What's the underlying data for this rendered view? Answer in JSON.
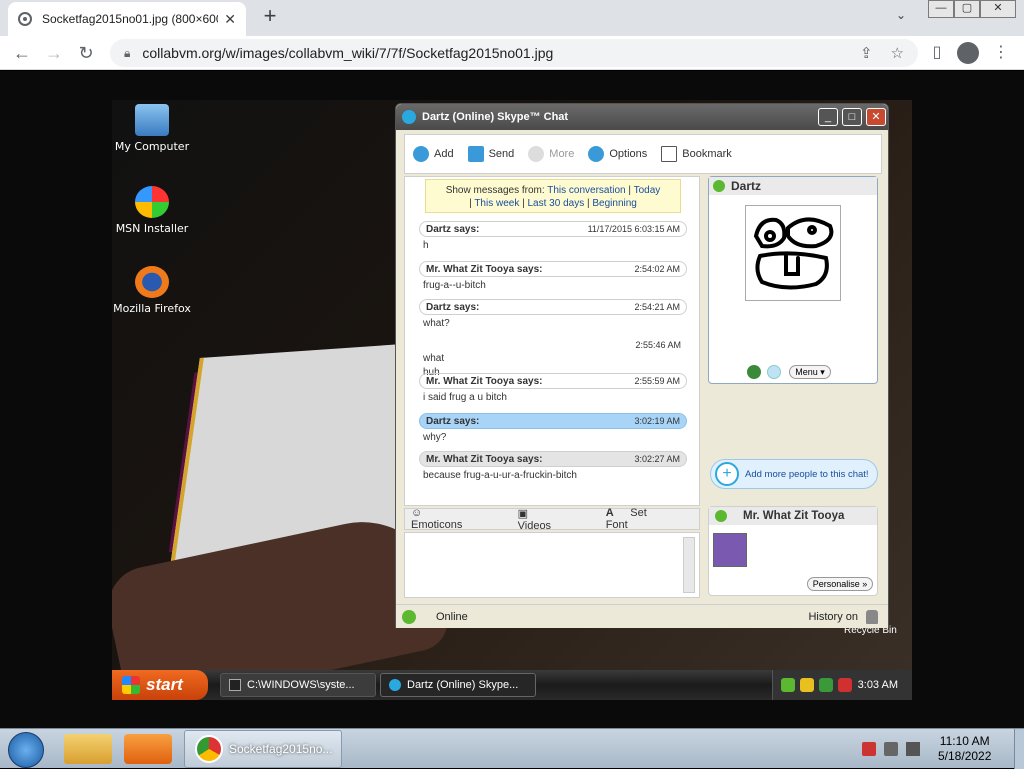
{
  "browser": {
    "tab_title": "Socketfag2015no01.jpg (800×600)",
    "tab_close": "✕",
    "new_tab": "+",
    "url": "collabvm.org/w/images/collabvm_wiki/7/7f/Socketfag2015no01.jpg",
    "back": "←",
    "forward": "→",
    "reload": "↻",
    "share": "⇪",
    "star": "☆",
    "min": "—",
    "max": "▢",
    "close": "✕",
    "tab_list": "⌄",
    "sidebar": "▯",
    "menu": "⋮"
  },
  "desktop": {
    "icons": [
      "My Computer",
      "MSN Installer",
      "Mozilla Firefox"
    ],
    "recycle_bin": "Recycle Bin"
  },
  "skype": {
    "title": "Dartz (Online) Skype™ Chat",
    "min": "_",
    "max": "□",
    "close": "✕",
    "toolbar": {
      "add": "Add",
      "send": "Send",
      "more": "More",
      "options": "Options",
      "bookmark": "Bookmark"
    },
    "filter": {
      "label": "Show messages from:",
      "this_conversation": "This conversation",
      "today": "Today",
      "this_week": "This week",
      "last_30": "Last 30 days",
      "beginning": "Beginning"
    },
    "messages": [
      {
        "sender": "Dartz says:",
        "time": "11/17/2015 6:03:15 AM",
        "text": "h",
        "style": "plain"
      },
      {
        "sender": "Mr. What Zit Tooya says:",
        "time": "2:54:02 AM",
        "text": "frug-a--u-bitch",
        "style": "plain"
      },
      {
        "sender": "Dartz says:",
        "time": "2:54:21 AM",
        "text": "what?",
        "style": "plain"
      },
      {
        "sender": "",
        "time": "2:55:46 AM",
        "text": "what",
        "style": "plain"
      },
      {
        "sender": "",
        "time": "",
        "text": "huh",
        "style": "plain"
      },
      {
        "sender": "Mr. What Zit Tooya says:",
        "time": "2:55:59 AM",
        "text": "i said frug a u bitch",
        "style": "plain"
      },
      {
        "sender": "Dartz says:",
        "time": "3:02:19 AM",
        "text": "why?",
        "style": "selected"
      },
      {
        "sender": "Mr. What Zit Tooya says:",
        "time": "3:02:27 AM",
        "text": "because frug-a-u-ur-a-fruckin-bitch",
        "style": "gray"
      }
    ],
    "emoticons": "Emoticons",
    "videos": "Videos",
    "set_font": "Set Font",
    "contact_name": "Dartz",
    "contact_menu": "Menu ▾",
    "add_people": "Add more people to this chat!",
    "my_name": "Mr. What Zit Tooya",
    "personalise": "Personalise »",
    "status": "Online",
    "history": "History on"
  },
  "xp_taskbar": {
    "start": "start",
    "tasks": [
      "C:\\WINDOWS\\syste...",
      "Dartz (Online) Skype..."
    ],
    "clock": "3:03 AM"
  },
  "win7": {
    "chrome_task": "Socketfag2015no...",
    "time": "11:10 AM",
    "date": "5/18/2022"
  }
}
